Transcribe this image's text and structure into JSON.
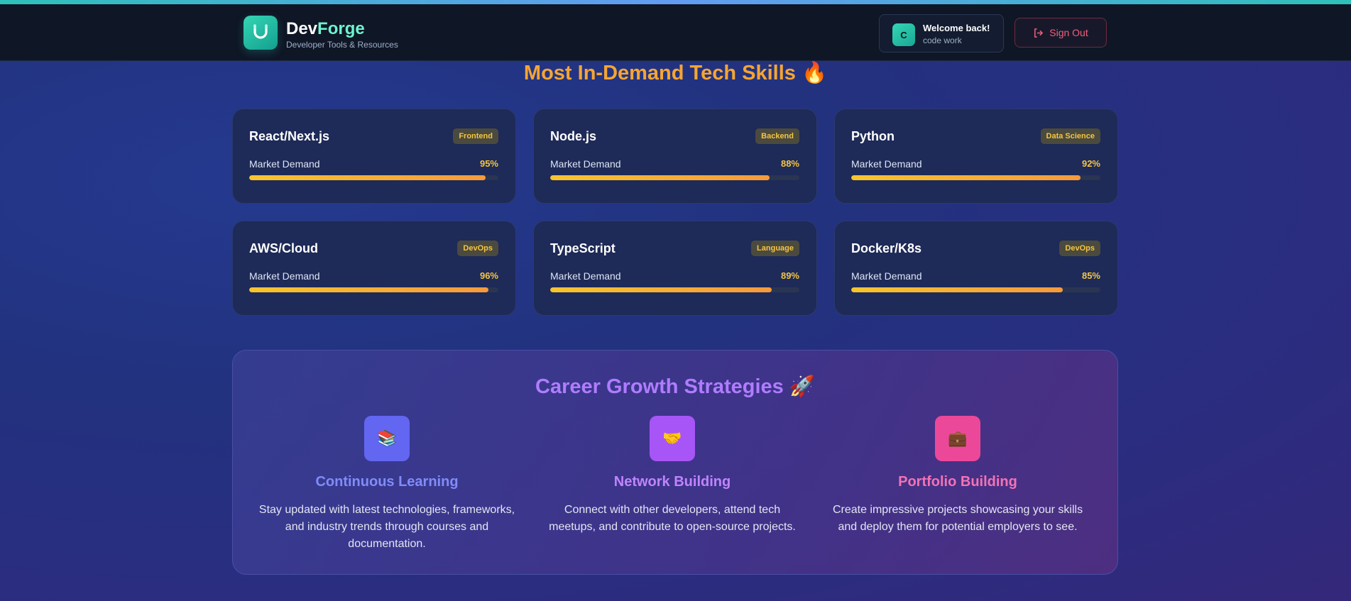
{
  "header": {
    "brand_part1": "Dev",
    "brand_part2": "Forge",
    "subtitle": "Developer Tools & Resources",
    "logo_icon": "horseshoe-magnet-icon",
    "user": {
      "avatar_initial": "C",
      "welcome": "Welcome back!",
      "username": "code work"
    },
    "signout_label": "Sign Out",
    "signout_icon": "sign-out-icon"
  },
  "skills_section": {
    "title": "Most In-Demand Tech Skills 🔥",
    "demand_label": "Market Demand",
    "skills": [
      {
        "name": "React/Next.js",
        "category": "Frontend",
        "demand": "95%",
        "demand_value": 95
      },
      {
        "name": "Node.js",
        "category": "Backend",
        "demand": "88%",
        "demand_value": 88
      },
      {
        "name": "Python",
        "category": "Data Science",
        "demand": "92%",
        "demand_value": 92
      },
      {
        "name": "AWS/Cloud",
        "category": "DevOps",
        "demand": "96%",
        "demand_value": 96
      },
      {
        "name": "TypeScript",
        "category": "Language",
        "demand": "89%",
        "demand_value": 89
      },
      {
        "name": "Docker/K8s",
        "category": "DevOps",
        "demand": "85%",
        "demand_value": 85
      }
    ]
  },
  "career_section": {
    "title": "Career Growth Strategies 🚀",
    "strategies": [
      {
        "icon": "📚",
        "icon_name": "books-icon",
        "icon_bg": "#6366f1",
        "title": "Continuous Learning",
        "title_color": "#818cf8",
        "description": "Stay updated with latest technologies, frameworks, and industry trends through courses and documentation."
      },
      {
        "icon": "🤝",
        "icon_name": "handshake-icon",
        "icon_bg": "#a855f7",
        "title": "Network Building",
        "title_color": "#c084fc",
        "description": "Connect with other developers, attend tech meetups, and contribute to open-source projects."
      },
      {
        "icon": "💼",
        "icon_name": "briefcase-icon",
        "icon_bg": "#ec4899",
        "title": "Portfolio Building",
        "title_color": "#f472b6",
        "description": "Create impressive projects showcasing your skills and deploy them for potential employers to see."
      }
    ]
  },
  "colors": {
    "accent_teal": "#35d6b4",
    "demand_gold": "#f5c542",
    "section_title_orange": "#f5a534",
    "career_title_purple": "#b07cff",
    "signout_red": "#f0607a"
  }
}
